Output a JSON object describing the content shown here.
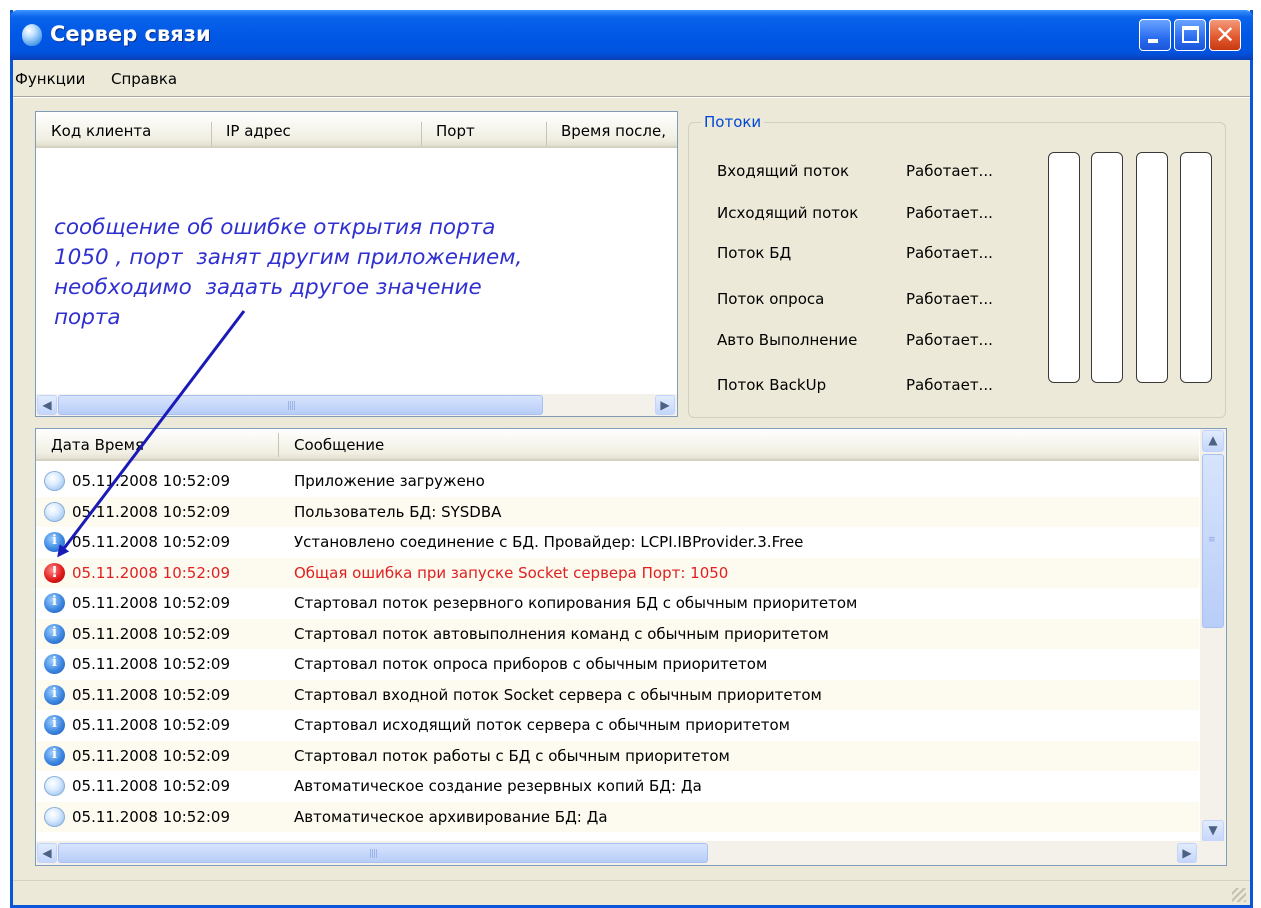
{
  "window": {
    "title": "Сервер связи"
  },
  "menu": [
    "Функции",
    "Справка"
  ],
  "clients": {
    "columns": [
      "Код клиента",
      "IP адрес",
      "Порт",
      "Время после,"
    ],
    "rows": []
  },
  "annotation": "сообщение об ошибке открытия порта\n1050 , порт  занят другим приложением,\nнеобходимо  задать другое значение\nпорта",
  "threads": {
    "legend": "Потоки",
    "items": [
      {
        "name": "Входящий поток",
        "status": "Работает..."
      },
      {
        "name": "Исходящий поток",
        "status": "Работает..."
      },
      {
        "name": "Поток БД",
        "status": "Работает..."
      },
      {
        "name": "Поток опроса",
        "status": "Работает..."
      },
      {
        "name": "Авто Выполнение",
        "status": "Работает..."
      },
      {
        "name": "Поток BackUp",
        "status": "Работает..."
      }
    ],
    "meter_count": 4
  },
  "log": {
    "columns": [
      "Дата Время",
      "Сообщение"
    ],
    "rows": [
      {
        "icon": "message-icon",
        "datetime": "05.11.2008 10:52:09",
        "message": "Приложение загружено"
      },
      {
        "icon": "message-icon",
        "datetime": "05.11.2008 10:52:09",
        "message": "Пользователь БД: SYSDBA"
      },
      {
        "icon": "info-icon",
        "datetime": "05.11.2008 10:52:09",
        "message": "Установлено соединение с БД. Провайдер: LCPI.IBProvider.3.Free"
      },
      {
        "icon": "error-icon",
        "datetime": "05.11.2008 10:52:09",
        "message": "Общая ошибка при запуске Socket сервера Порт: 1050",
        "error": true
      },
      {
        "icon": "info-icon",
        "datetime": "05.11.2008 10:52:09",
        "message": "Стартовал поток резервного копирования БД с обычным приоритетом"
      },
      {
        "icon": "info-icon",
        "datetime": "05.11.2008 10:52:09",
        "message": "Стартовал поток автовыполнения команд с обычным приоритетом"
      },
      {
        "icon": "info-icon",
        "datetime": "05.11.2008 10:52:09",
        "message": "Стартовал поток опроса приборов с обычным приоритетом"
      },
      {
        "icon": "info-icon",
        "datetime": "05.11.2008 10:52:09",
        "message": "Стартовал входной поток Socket сервера с обычным приоритетом"
      },
      {
        "icon": "info-icon",
        "datetime": "05.11.2008 10:52:09",
        "message": "Стартовал исходящий поток сервера с обычным приоритетом"
      },
      {
        "icon": "info-icon",
        "datetime": "05.11.2008 10:52:09",
        "message": "Стартовал поток работы с БД с обычным приоритетом"
      },
      {
        "icon": "message-icon",
        "datetime": "05.11.2008 10:52:09",
        "message": "Автоматическое создание резервных копий БД: Да"
      },
      {
        "icon": "message-icon",
        "datetime": "05.11.2008 10:52:09",
        "message": "Автоматическое архивирование БД: Да"
      }
    ]
  },
  "colors": {
    "titlebar": "#0058e6",
    "annotation": "#3030d0",
    "arrow": "#1a1ab8",
    "error_text": "#e02020",
    "group_legend": "#0046d5"
  }
}
